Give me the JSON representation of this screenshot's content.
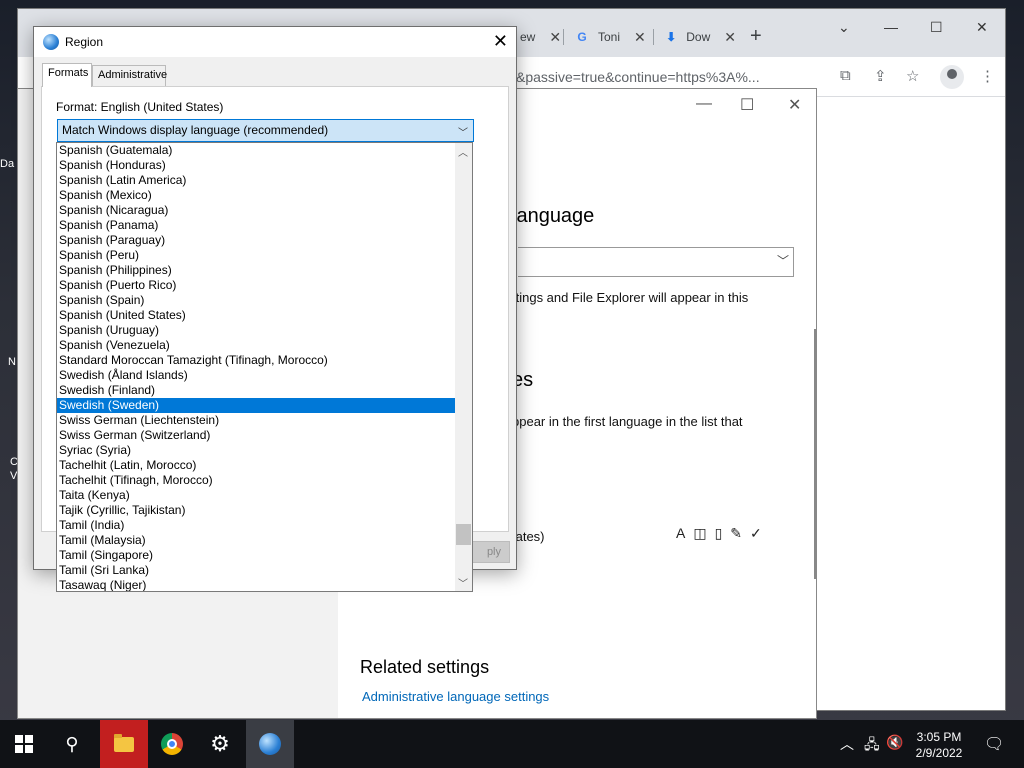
{
  "desktop": {
    "fragments": [
      "Da",
      "N",
      "C",
      "V"
    ]
  },
  "chrome": {
    "tabs": [
      {
        "label": "ew"
      },
      {
        "label": "Toni"
      },
      {
        "label": "Dow"
      }
    ],
    "address_text": "e&uilel=3&passive=true&continue=https%3A%..."
  },
  "settings": {
    "heading_language": "language",
    "text_explorer": "ttings and File Explorer will appear in this",
    "heading_languages": "es",
    "text_first_language": "ppear in the first language in the list that",
    "text_states": "tates)",
    "related_heading": "Related settings",
    "admin_link": "Administrative language settings"
  },
  "region": {
    "title": "Region",
    "tabs": [
      "Formats",
      "Administrative"
    ],
    "format_label": "Format: English (United States)",
    "format_value": "Match Windows display language (recommended)",
    "apply_label": "ply",
    "list_items": [
      "Spanish (Guatemala)",
      "Spanish (Honduras)",
      "Spanish (Latin America)",
      "Spanish (Mexico)",
      "Spanish (Nicaragua)",
      "Spanish (Panama)",
      "Spanish (Paraguay)",
      "Spanish (Peru)",
      "Spanish (Philippines)",
      "Spanish (Puerto Rico)",
      "Spanish (Spain)",
      "Spanish (United States)",
      "Spanish (Uruguay)",
      "Spanish (Venezuela)",
      "Standard Moroccan Tamazight (Tifinagh, Morocco)",
      "Swedish (Åland Islands)",
      "Swedish (Finland)",
      "Swedish (Sweden)",
      "Swiss German (Liechtenstein)",
      "Swiss German (Switzerland)",
      "Syriac (Syria)",
      "Tachelhit (Latin, Morocco)",
      "Tachelhit (Tifinagh, Morocco)",
      "Taita (Kenya)",
      "Tajik (Cyrillic, Tajikistan)",
      "Tamil (India)",
      "Tamil (Malaysia)",
      "Tamil (Singapore)",
      "Tamil (Sri Lanka)",
      "Tasawaq (Niger)"
    ],
    "selected_item": "Swedish (Sweden)"
  },
  "taskbar": {
    "time": "3:05 PM",
    "date": "2/9/2022"
  }
}
